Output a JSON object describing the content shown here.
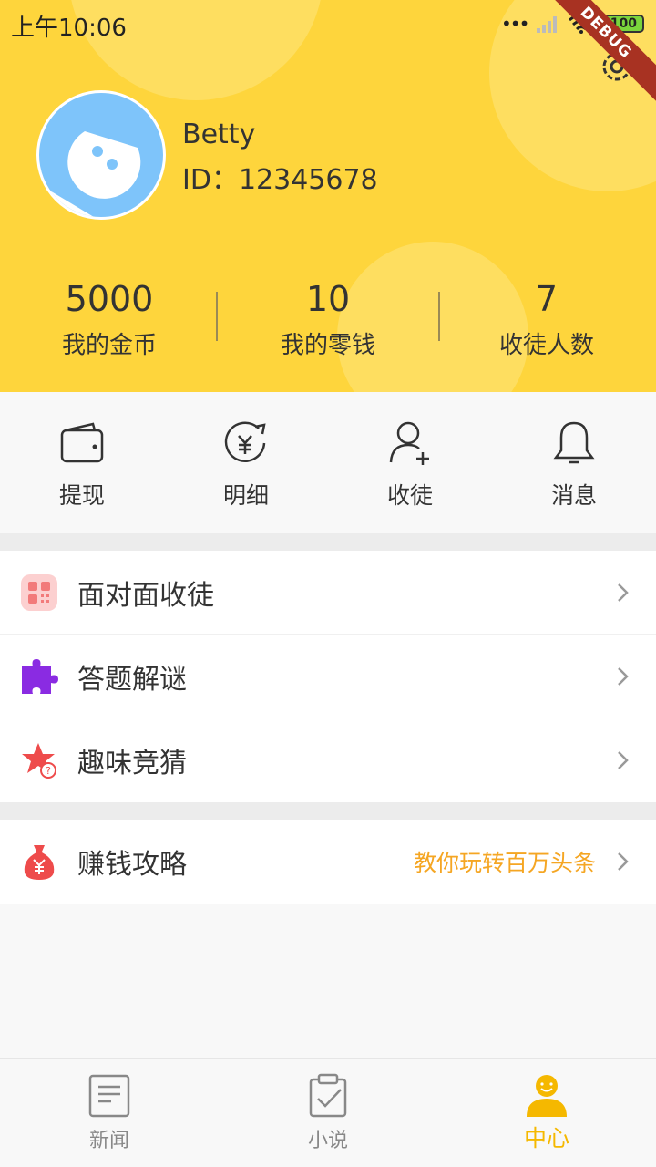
{
  "status_bar": {
    "time": "上午10:06",
    "battery": "100"
  },
  "debug_banner": "DEBUG",
  "profile": {
    "name": "Betty",
    "id_text": "ID：12345678"
  },
  "stats": [
    {
      "value": "5000",
      "label": "我的金币"
    },
    {
      "value": "10",
      "label": "我的零钱"
    },
    {
      "value": "7",
      "label": "收徒人数"
    }
  ],
  "actions": [
    {
      "label": "提现",
      "icon": "wallet-icon"
    },
    {
      "label": "明细",
      "icon": "yuan-history-icon"
    },
    {
      "label": "收徒",
      "icon": "add-user-icon"
    },
    {
      "label": "消息",
      "icon": "bell-icon"
    }
  ],
  "menu_group1": [
    {
      "label": "面对面收徒",
      "icon": "qr-code-icon"
    },
    {
      "label": "答题解谜",
      "icon": "puzzle-icon"
    },
    {
      "label": "趣味竞猜",
      "icon": "star-question-icon"
    }
  ],
  "menu_group2": [
    {
      "label": "赚钱攻略",
      "sub": "教你玩转百万头条",
      "icon": "money-bag-icon"
    }
  ],
  "bottom_nav": [
    {
      "label": "新闻",
      "icon": "news-icon",
      "active": false
    },
    {
      "label": "小说",
      "icon": "novel-icon",
      "active": false
    },
    {
      "label": "中心",
      "icon": "user-center-icon",
      "active": true
    }
  ],
  "colors": {
    "header": "#fed53c",
    "accent": "#f5b800",
    "sub_text": "#f5a623"
  }
}
